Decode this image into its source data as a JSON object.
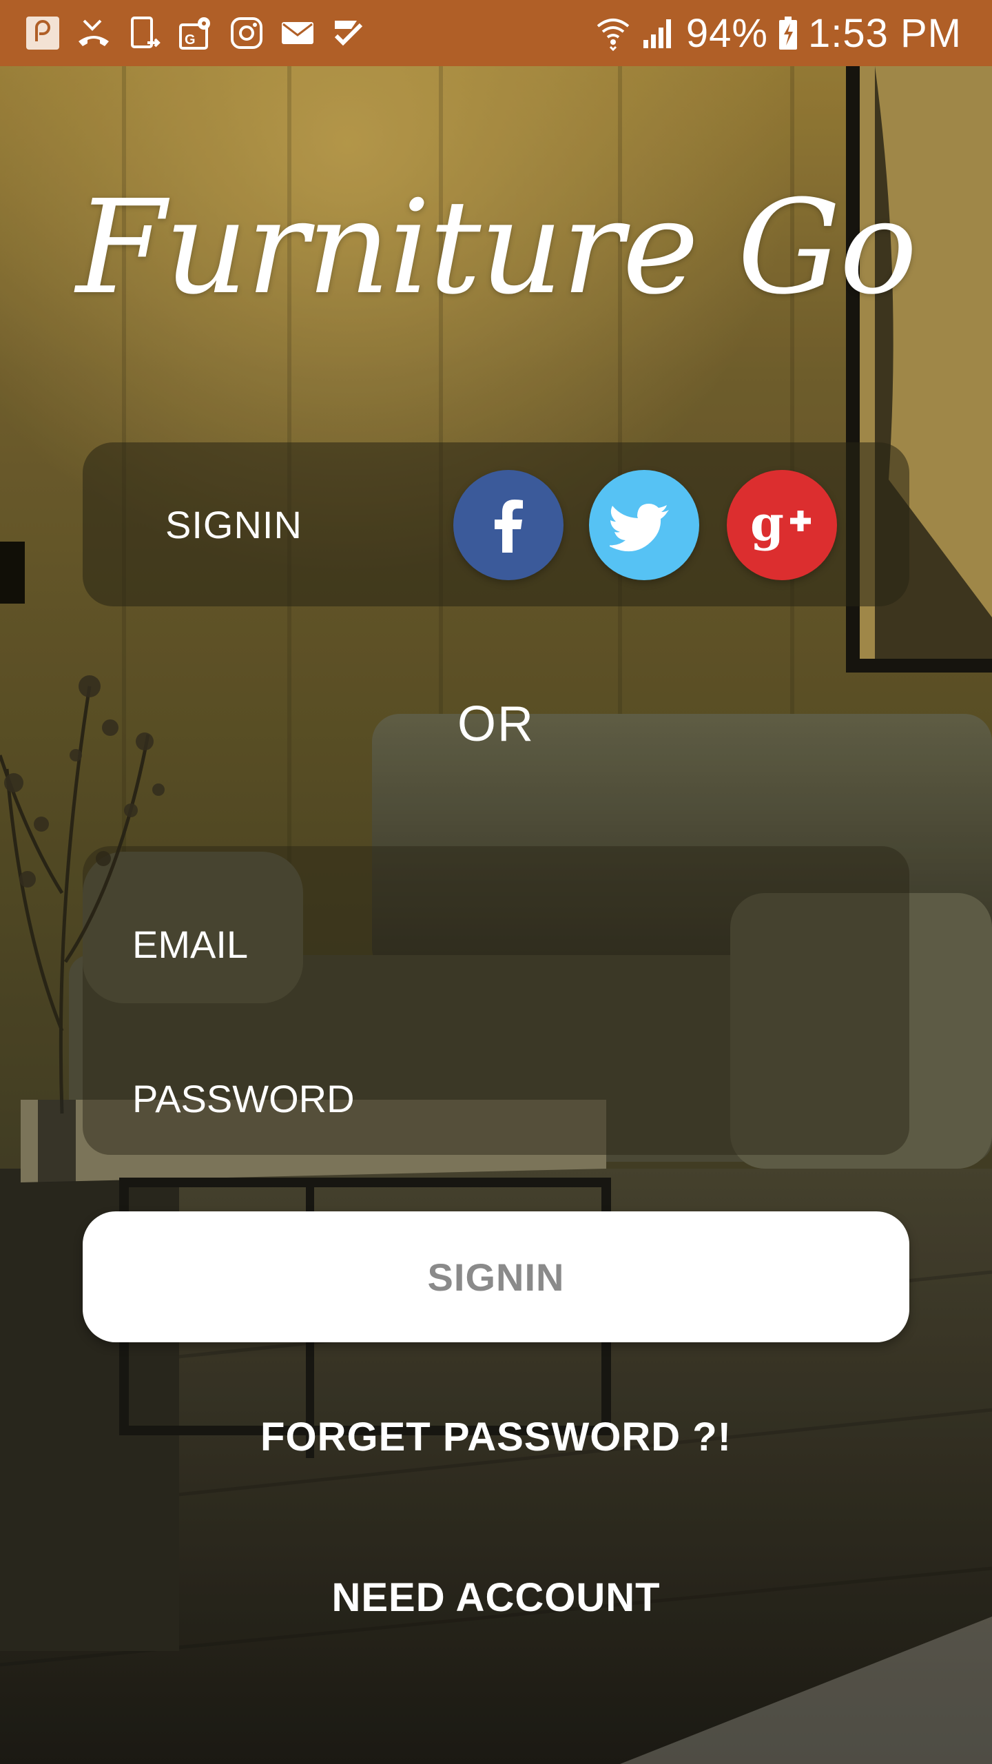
{
  "status_bar": {
    "battery": "94%",
    "clock": "1:53 PM",
    "left_icons": [
      "pocket-icon",
      "missed-call-icon",
      "tablet-sync-icon",
      "maps-icon",
      "instagram-icon",
      "mail-icon",
      "checkmark-app-icon"
    ],
    "right_icons": [
      "wifi-icon",
      "signal-icon",
      "battery-charging-icon"
    ]
  },
  "app": {
    "title": "Furniture Go"
  },
  "social": {
    "label": "SIGNIN",
    "buttons": [
      "facebook",
      "twitter",
      "google-plus"
    ]
  },
  "divider": {
    "text": "OR"
  },
  "form": {
    "email_placeholder": "EMAIL",
    "email_value": "",
    "password_placeholder": "PASSWORD",
    "password_value": ""
  },
  "actions": {
    "signin_label": "SIGNIN",
    "forget_label": "FORGET PASSWORD ?!",
    "need_account_label": "NEED ACCOUNT"
  },
  "colors": {
    "status_bar": "#b05f27",
    "facebook": "#3b5a9a",
    "twitter": "#56c2f4",
    "google_plus": "#dc2e2f",
    "button_bg": "#ffffff",
    "button_text": "#8a8a8a"
  }
}
